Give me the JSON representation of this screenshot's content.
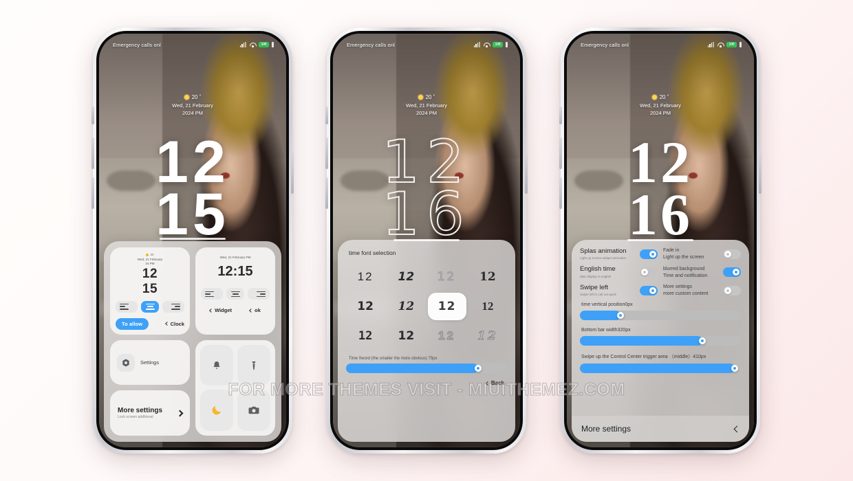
{
  "meta": {
    "watermark": "FOR MORE THEMES VISIT - MIUITHEMEZ.COM",
    "accent_blue": "#3EA1F7",
    "background": "#FFF7F5"
  },
  "status_bar": {
    "carrier_text": "Emergency calls onl",
    "battery_text": "100",
    "icons": [
      "signal-icon",
      "wifi-icon",
      "battery-icon",
      "battery-secondary-icon"
    ]
  },
  "lock_screen": {
    "temperature": "20 ˚",
    "date": "Wed, 21 February",
    "year_period": "2024 PM",
    "time_line1": "12",
    "time_line2_phone1": "15",
    "time_line2_phone2": "16",
    "time_line2_phone3": "16"
  },
  "phone1": {
    "preview_left": {
      "weather": "20",
      "date": "Wed, 21 February",
      "time_label": "24 PM",
      "clock_line1": "12",
      "clock_line2": "15",
      "align_options": [
        "align-left",
        "align-center",
        "align-right"
      ],
      "align_selected": 1,
      "primary_button": "To allow",
      "back_link": "Clock"
    },
    "preview_right": {
      "date": "Wed, 21 February PM",
      "clock": "12:15",
      "align_options": [
        "align-left",
        "align-center",
        "align-right"
      ],
      "align_selected": -1,
      "back_link_1": "Widget",
      "back_link_2": "ok"
    },
    "settings_card": {
      "label": "Settings",
      "icon": "gear-icon"
    },
    "more_card": {
      "title": "More settings",
      "subtitle": "Lock screen additional",
      "icon": "chevron-right-icon"
    },
    "quick_actions": [
      {
        "name": "bell-icon"
      },
      {
        "name": "flashlight-icon"
      },
      {
        "name": "moon-icon"
      },
      {
        "name": "camera-icon"
      }
    ]
  },
  "phone2": {
    "title": "time font selection",
    "fonts": [
      {
        "label": "12",
        "style": "f-sans",
        "selected": false
      },
      {
        "label": "12",
        "style": "f-bolditalic",
        "selected": false
      },
      {
        "label": "12",
        "style": "f-outline",
        "selected": false
      },
      {
        "label": "12",
        "style": "f-slab",
        "selected": false
      },
      {
        "label": "12",
        "style": "f-heavy",
        "selected": false
      },
      {
        "label": "12",
        "style": "f-ital2",
        "selected": false
      },
      {
        "label": "12",
        "style": "f-sel",
        "selected": true
      },
      {
        "label": "12",
        "style": "f-cond",
        "selected": false
      },
      {
        "label": "12",
        "style": "f-mono",
        "selected": false
      },
      {
        "label": "12",
        "style": "f-heavy",
        "selected": false
      },
      {
        "label": "12",
        "style": "f-out2",
        "selected": false
      },
      {
        "label": "12",
        "style": "f-out3",
        "selected": false
      }
    ],
    "slider_label": "Time 0word (the smaller the more obvious) 75px",
    "slider_percent": 82,
    "back_link": "Back"
  },
  "phone3": {
    "toggles": [
      {
        "title": "Splas animation",
        "subtitle": "Light up screen widget animation",
        "on": true,
        "size": "big"
      },
      {
        "title": "Fade in",
        "subtitle": "Light up the screen",
        "on": false,
        "size": "small"
      },
      {
        "title": "English time",
        "subtitle": "date display in english",
        "on": false,
        "size": "big"
      },
      {
        "title": "blurred background",
        "subtitle": "Time and notification",
        "on": true,
        "size": "small"
      },
      {
        "title": "Swipe left",
        "subtitle": "Swipe left to call out quick",
        "on": true,
        "size": "big"
      },
      {
        "title": "More settings",
        "subtitle": "more custom content",
        "on": false,
        "size": "small"
      }
    ],
    "sliders": [
      {
        "label": "time vertical position0px",
        "percent": 25
      },
      {
        "label": "Bottom bar width320px",
        "percent": 76
      },
      {
        "label": "Swipe up the Control Center trigger area （middle）410px",
        "percent": 96
      }
    ],
    "footer": {
      "title": "More settings",
      "icon": "chevron-left-icon"
    }
  }
}
